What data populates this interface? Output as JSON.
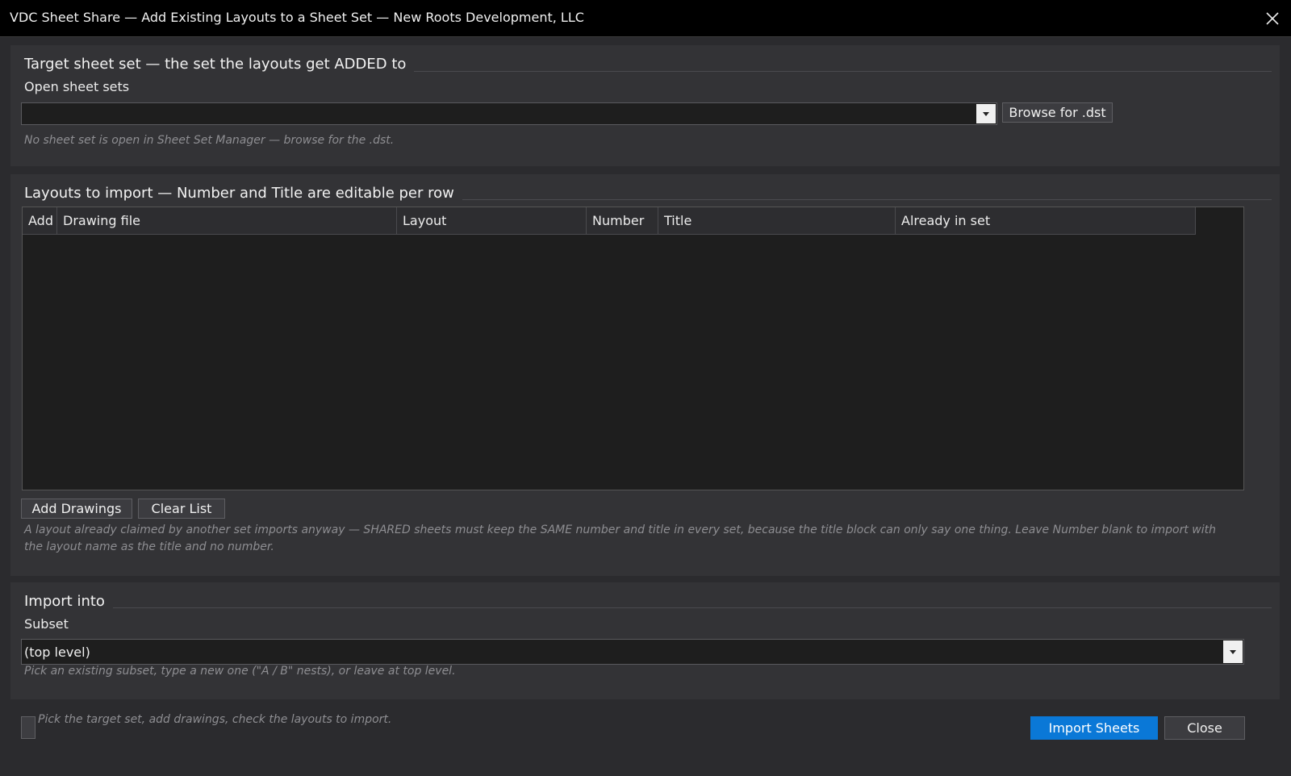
{
  "window": {
    "title": "VDC Sheet Share — Add Existing Layouts to a Sheet Set — New Roots Development, LLC",
    "close_icon": "close-icon"
  },
  "target": {
    "section_title": "Target sheet set — the set the layouts get ADDED to",
    "open_label": "Open sheet sets",
    "selected_value": "",
    "browse_label": "Browse for .dst",
    "hint": "No sheet set is open in Sheet Set Manager — browse for the .dst."
  },
  "layouts": {
    "section_title": "Layouts to import — Number and Title are editable per row",
    "columns": [
      "Add",
      "Drawing file",
      "Layout",
      "Number",
      "Title",
      "Already in set"
    ],
    "rows": [],
    "add_drawings_label": "Add Drawings",
    "clear_list_label": "Clear List",
    "hint": "A layout already claimed by another set imports anyway — SHARED sheets must keep the SAME number and title in every set, because the title block can only say one thing. Leave Number blank to import with the layout name as the title and no number."
  },
  "import_into": {
    "section_title": "Import into",
    "subset_label": "Subset",
    "subset_value": "(top level)",
    "hint": "Pick an existing subset, type a new one (\"A / B\" nests), or leave at top level."
  },
  "footer": {
    "status": "Pick the target set, add drawings, check the layouts to import.",
    "import_label": "Import Sheets",
    "close_label": "Close"
  },
  "colors": {
    "accent": "#0a78d7",
    "background": "#2b2b2e",
    "panel": "#333336",
    "titlebar": "#000000"
  }
}
